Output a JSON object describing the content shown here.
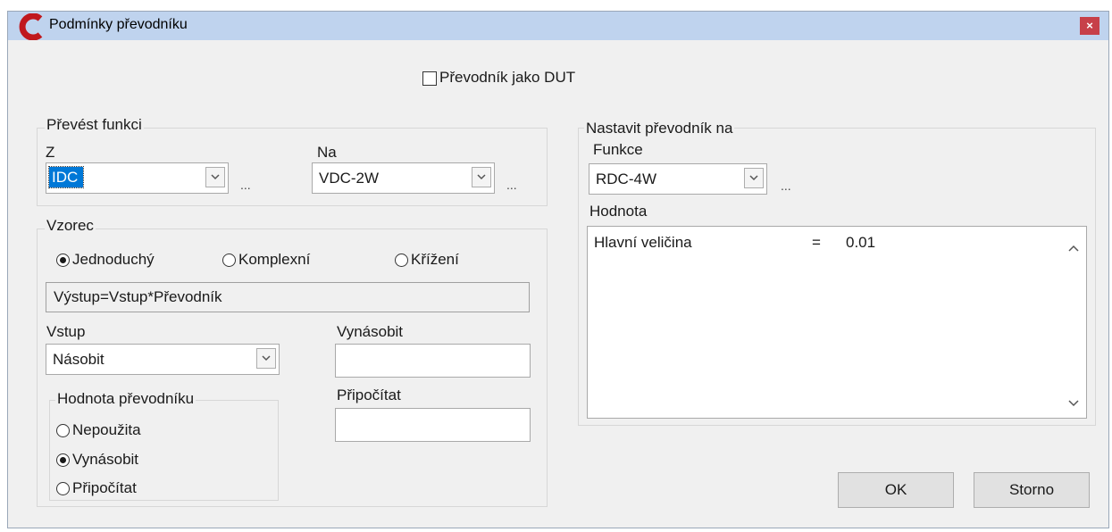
{
  "window": {
    "title": "Podmínky převodníku",
    "close_label": "×"
  },
  "dut_checkbox": {
    "label": "Převodník jako DUT",
    "checked": false
  },
  "convert": {
    "title": "Převést funkci",
    "from_label": "Z",
    "from_value": "IDC",
    "to_label": "Na",
    "to_value": "VDC-2W",
    "dots": "..."
  },
  "formula": {
    "title": "Vzorec",
    "options": [
      "Jednoduchý",
      "Komplexní",
      "Křížení"
    ],
    "selected": "Jednoduchý",
    "expression": "Výstup=Vstup*Převodník"
  },
  "input": {
    "label": "Vstup",
    "value": "Násobit"
  },
  "multiply": {
    "label": "Vynásobit",
    "value": ""
  },
  "add": {
    "label": "Připočítat",
    "value": ""
  },
  "converter_value": {
    "title": "Hodnota převodníku",
    "options": [
      "Nepoužita",
      "Vynásobit",
      "Připočítat"
    ],
    "selected": "Vynásobit"
  },
  "set_converter": {
    "title": "Nastavit převodník na",
    "function_label": "Funkce",
    "function_value": "RDC-4W",
    "dots": "...",
    "value_label": "Hodnota",
    "rows": [
      {
        "name": "Hlavní veličina",
        "eq": "=",
        "value": "0.01"
      }
    ]
  },
  "buttons": {
    "ok": "OK",
    "cancel": "Storno"
  }
}
